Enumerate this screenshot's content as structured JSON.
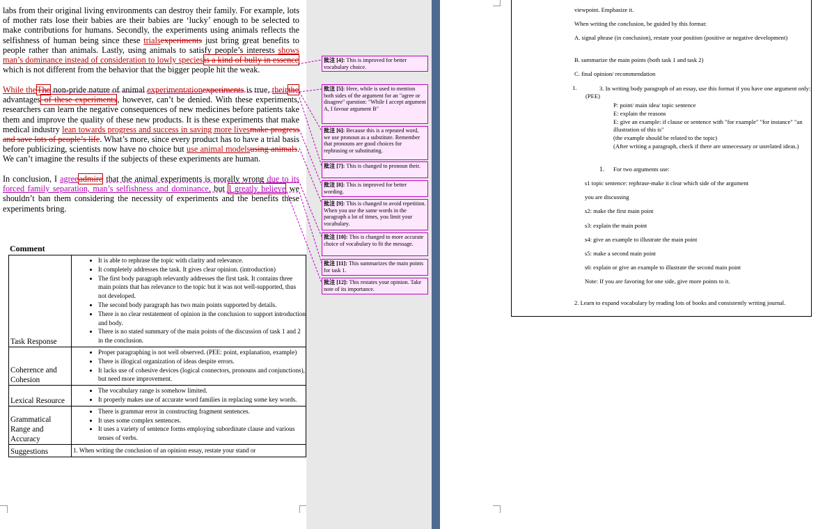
{
  "essay": {
    "p1": {
      "t1": "labs from their original living environments can destroy their family. For example, lots of mother rats lose their babies are their babies are ‘lucky’ enough to be selected to make contributions for humans. Secondly, the experiments using animals reflects the selfishness of human being since these ",
      "ins1": "trials",
      "del1": "experiments",
      "t2": " just bring great benefits to people rather than animals. Lastly, using animals to satisfy people’s interests ",
      "ins2": "shows man’s dominance instead of consideration to lowly species",
      "del2": "is a kind of bully in essence",
      "t3": " which is not different from the behavior that the bigger people hit the weak."
    },
    "p2": {
      "ins1": "While the",
      "del1": "The",
      "t1": " non-pride nature of animal ",
      "ins2": "experimentation",
      "del2": "experiments",
      "t2": " is true, ",
      "ins3": "their",
      "del3": "the",
      "t3": " advantages",
      "del4": " of these experiments",
      "t4": ", however, can’t be denied. With these experiments, researchers can learn the negative consequences of new medicines before patients take them and improve the quality of these new products. It is these experiments that make medical industry ",
      "ins4": "lean towards progress and success in saving more lives",
      "del5": "make progress and save lots of people’s life",
      "t5": ". What’s more, since every product has to have a trial basis before publicizing, scientists now have no choice but ",
      "ins5": "use animal models",
      "del6": "using animals",
      "t6": ". We can’t imagine the results if the subjects of these experiments are human."
    },
    "p3": {
      "t1": "In conclusion, I ",
      "ins1": "agree",
      "del1": "admire",
      "t2": " that the animal experiments is morally wrong ",
      "ins2": "due to its forced family separation, man’s selfishness and dominance.",
      "t3": " but ",
      "ins3": "I greatly believe",
      "t4": " we shouldn’t ban them considering the necessity of experiments and the benefits these experiments bring."
    }
  },
  "comment_heading": "Comment",
  "rubric": [
    {
      "criterion": "Task Response",
      "points": [
        "It is able to rephrase the topic with clarity and relevance.",
        "It completely addresses the task. It gives clear opinion. (introduction)",
        "The first body paragraph relevantly addresses the first task. It contains three main points that has relevance to the topic but it was not well-supported, thus not developed.",
        "The second body paragraph has two main points supported by details.",
        "There is no clear restatement of opinion in the conclusion to support introduction and body.",
        "There is no stated summary of the main points of the discussion of task 1 and 2 in the conclusion."
      ]
    },
    {
      "criterion": "Coherence and Cohesion",
      "points": [
        "Proper paragraphing is not well observed. (PEE: point, explanation, example)",
        "There is illogical organization of ideas despite errors.",
        "It lacks use of cohesive devices (logical connectors, pronouns and conjunctions), but need more improvement."
      ]
    },
    {
      "criterion": "Lexical Resource",
      "points": [
        "The vocabulary range is somehow limited.",
        "It properly makes use of accurate word families in replacing some key words."
      ]
    },
    {
      "criterion": "Grammatical Range and Accuracy",
      "points": [
        "There is grammar error in constructing fragment sentences.",
        "It uses some complex sentences.",
        "It uses a variety of sentence forms employing subordinate clause and various tenses of verbs."
      ]
    },
    {
      "criterion": "Suggestions",
      "text": "1. When writing the conclusion of an opinion essay, restate your stand or"
    }
  ],
  "comments": [
    {
      "label": "批注 [4]:",
      "text": "This is improved for better vocabulary choice."
    },
    {
      "label": "批注 [5]:",
      "text": "Here, while is used to mention both sides of the argument for an \"agree or disagree\" question: \"While I accept argument A, I favour argument B\""
    },
    {
      "label": "批注 [6]:",
      "text": "Because this is a repeated word, we use pronoun as a substitute. Remember that pronouns are good choices for rephrasing or substituting."
    },
    {
      "label": "批注 [7]:",
      "text": "This is changed to pronoun their."
    },
    {
      "label": "批注 [8]:",
      "text": "This is improved for better wording."
    },
    {
      "label": "批注 [9]:",
      "text": "This is changed to avoid repetition. When you use the same words in the paragraph a lot of times, you limit your vocabulary."
    },
    {
      "label": "批注 [10]:",
      "text": "This is changed to more accurate choice of vocabulary to fit the message."
    },
    {
      "label": "批注 [11]:",
      "text": "This summarizes the main points for task 1."
    },
    {
      "label": "批注 [12]:",
      "text": "This restates your opinion. Take note of its importance."
    }
  ],
  "right_page": {
    "l1": "viewpoint. Emphasize it.",
    "l2": "When writing the conclusion, be guided by this format:",
    "l3": "A. signal phrase (in conclusion), restate your position (positive or negative development)",
    "l4": "B. summarize the main points (both task 1 and task 2)",
    "l5": "C. final opinion/ recommendation",
    "l6": "3. In writing body paragraph of an essay, use this format if you have one argument only: (PEE)",
    "l7": "P: point/ main idea/ topic sentence",
    "l8": "E: explain the reasons",
    "l9": "E: give an example: if clause or sentence with \"for example\" \"for instance\" \"an illustration of this is\"",
    "l10": "(the example should be related to the topic)",
    "l11": "(After writing a paragraph, check if there are unnecessary or unrelated ideas.)",
    "l12": "For two arguments use:",
    "l13": "s1 topic sentence: rephrase-make it clear which side of the argument",
    "l14": "you are discussing",
    "l15": "s2: make the first main point",
    "l16": "s3: explain the main point",
    "l17": "s4: give an example to illustrate the main point",
    "l18": "s5: make a second main point",
    "l19": "s6: explain or give an example to illustrate the second main point",
    "l20": "Note: If you are favoring for one side, give more points to it.",
    "l21": "2. Learn to expand vocabulary by reading lots of books and consistently writing journal.",
    "list_num": "1.",
    "bullet_num": "1."
  }
}
